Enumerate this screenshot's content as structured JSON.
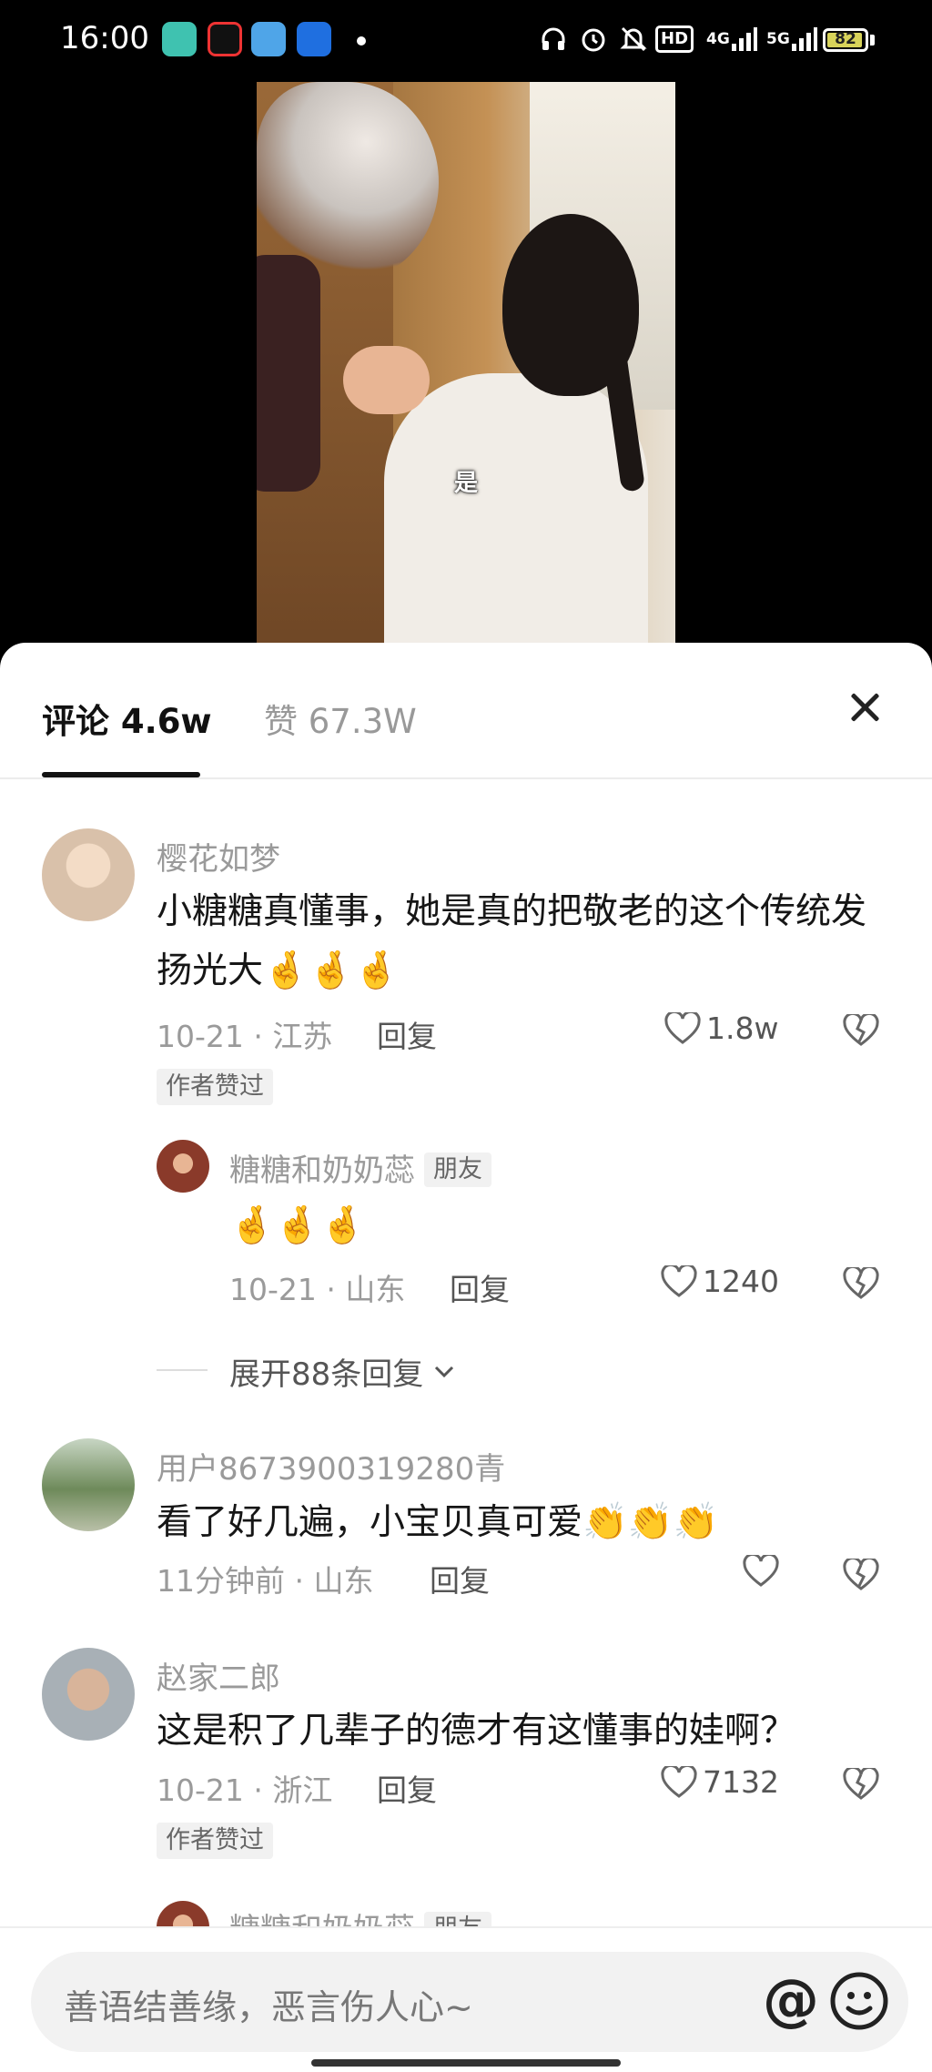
{
  "status_bar": {
    "time": "16:00",
    "hd_label": "HD",
    "net_4g": "4G",
    "net_5g": "5G",
    "battery": "82"
  },
  "video": {
    "subtitle": "是"
  },
  "tabs": {
    "comments_label": "评论",
    "comments_count": "4.6w",
    "likes_label": "赞",
    "likes_count": "67.3W"
  },
  "comments": [
    {
      "author": "樱花如梦",
      "text": "小糖糖真懂事，她是真的把敬老的这个传统发扬光大",
      "emojis": "🤞🤞🤞",
      "meta": "10-21 · 江苏",
      "reply_label": "回复",
      "likes": "1.8w",
      "badge": "作者赞过",
      "avatar_color": "#d9c1aa"
    },
    {
      "author": "用户8673900319280青",
      "text": "看了好几遍，小宝贝真可爱",
      "emojis": "👏👏👏",
      "meta": "11分钟前 · 山东",
      "reply_label": "回复",
      "likes": "",
      "avatar_color": "#6e8a5a"
    },
    {
      "author": "赵家二郎",
      "text": "这是积了几辈子的德才有这懂事的娃啊？",
      "meta": "10-21 · 浙江",
      "reply_label": "回复",
      "likes": "7132",
      "badge": "作者赞过",
      "avatar_color": "#a8b0b6"
    }
  ],
  "replies": [
    {
      "author": "糖糖和奶奶蕊",
      "tag": "朋友",
      "emojis": "🤞🤞🤞",
      "meta": "10-21 · 山东",
      "reply_label": "回复",
      "likes": "1240",
      "avatar_color": "#8a3a2a"
    },
    {
      "author": "糖糖和奶奶蕊",
      "tag": "朋友",
      "avatar_color": "#8a3a2a"
    }
  ],
  "expand_replies": "展开88条回复",
  "input": {
    "placeholder": "善语结善缘，恶言伤人心~",
    "at_symbol": "@"
  },
  "colors": {
    "accent_text": "#161616",
    "muted_text": "#9a9a9a",
    "panel_bg": "#ffffff"
  },
  "icons": [
    "headphone-icon",
    "alarm-icon",
    "mute-icon",
    "signal-icon",
    "battery-icon",
    "close-icon",
    "heart-icon",
    "dislike-icon",
    "at-icon",
    "emoji-icon",
    "chevron-down-icon"
  ]
}
